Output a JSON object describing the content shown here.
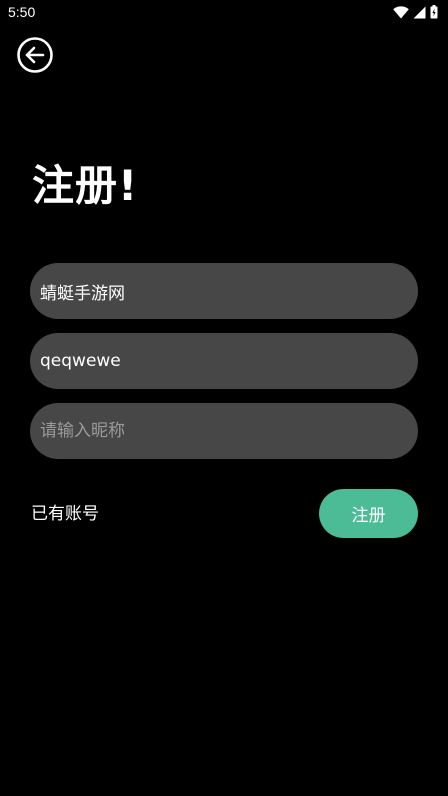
{
  "status_bar": {
    "time": "5:50",
    "icons": [
      "wifi-icon",
      "signal-icon",
      "battery-icon"
    ]
  },
  "header": {
    "back_icon": "back-arrow-circle-icon"
  },
  "title": "注册!",
  "form": {
    "field1": {
      "value": "蜻蜓手游网",
      "placeholder": ""
    },
    "field2": {
      "value": "qeqwewe",
      "placeholder": ""
    },
    "nickname": {
      "value": "",
      "placeholder": "请输入昵称"
    }
  },
  "footer": {
    "login_label": "已有账号",
    "register_label": "注册"
  },
  "colors": {
    "background": "#000000",
    "field_background": "#474747",
    "accent": "#4bbc95",
    "text": "#ffffff",
    "placeholder": "#9a9a9a"
  }
}
